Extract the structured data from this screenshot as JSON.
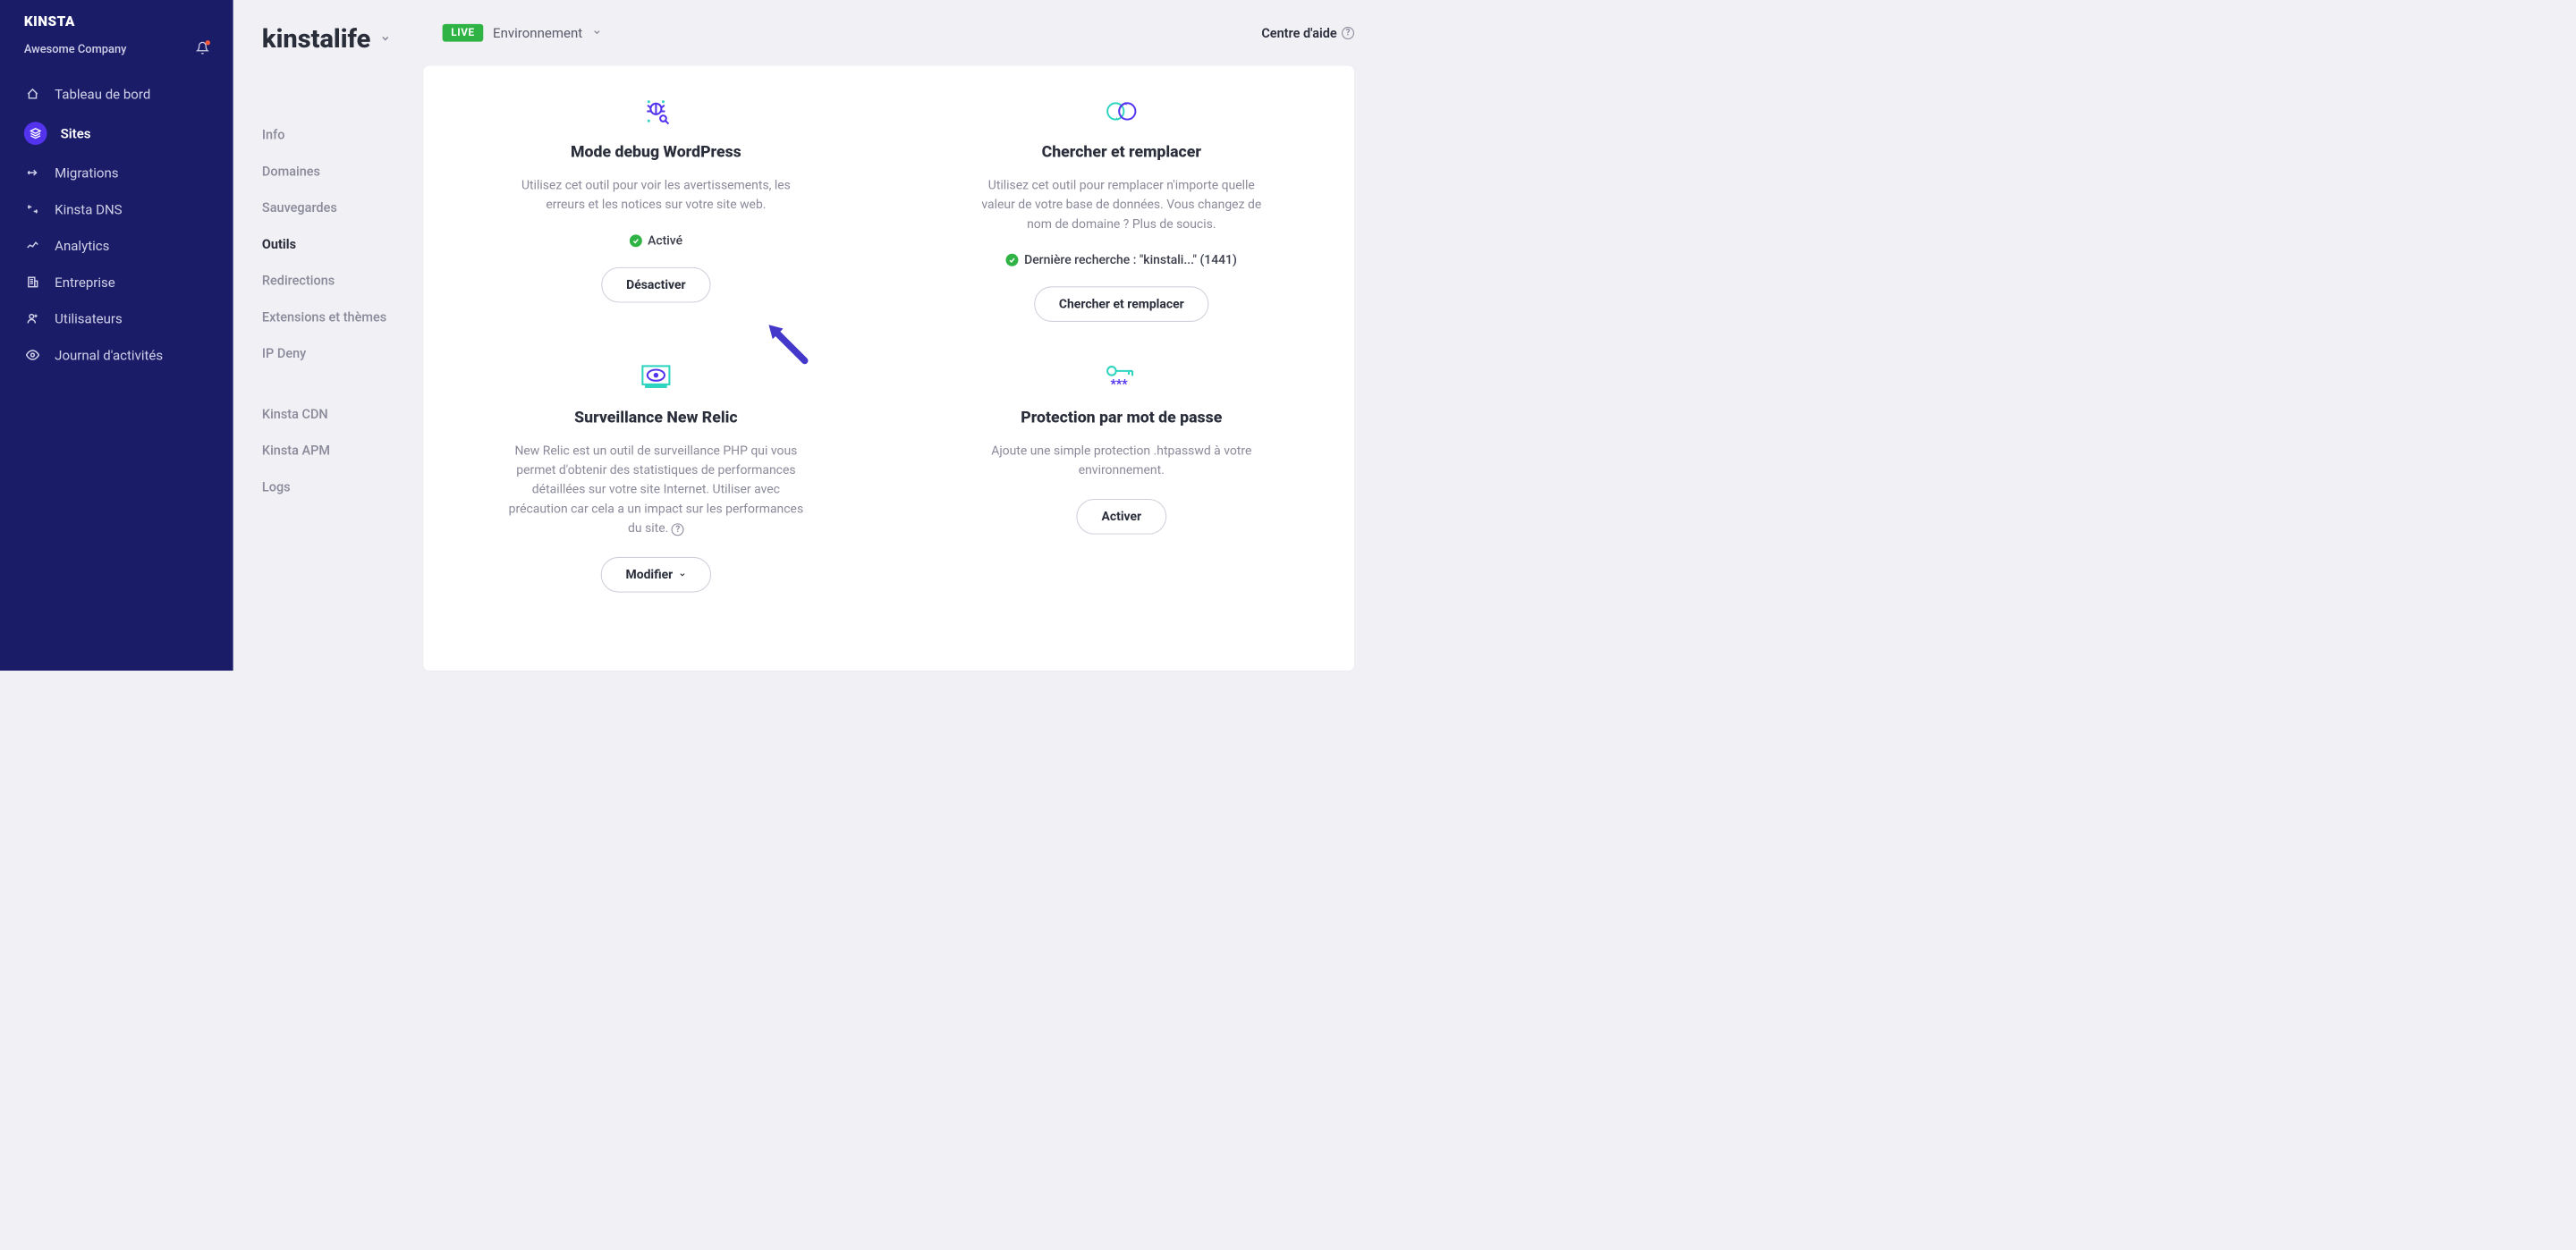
{
  "sidebar": {
    "company_name": "Awesome Company",
    "items": [
      {
        "label": "Tableau de bord",
        "icon": "home"
      },
      {
        "label": "Sites",
        "icon": "layers",
        "active": true
      },
      {
        "label": "Migrations",
        "icon": "arrow-right"
      },
      {
        "label": "Kinsta DNS",
        "icon": "dns"
      },
      {
        "label": "Analytics",
        "icon": "chart"
      },
      {
        "label": "Entreprise",
        "icon": "building"
      },
      {
        "label": "Utilisateurs",
        "icon": "user-plus"
      },
      {
        "label": "Journal d'activités",
        "icon": "eye"
      }
    ]
  },
  "site": {
    "name": "kinstalife",
    "env_badge": "LIVE",
    "env_label": "Environnement"
  },
  "help_link": "Centre d'aide",
  "subnav": {
    "items_a": [
      {
        "label": "Info"
      },
      {
        "label": "Domaines"
      },
      {
        "label": "Sauvegardes"
      },
      {
        "label": "Outils",
        "active": true
      },
      {
        "label": "Redirections"
      },
      {
        "label": "Extensions et thèmes"
      },
      {
        "label": "IP Deny"
      }
    ],
    "items_b": [
      {
        "label": "Kinsta CDN"
      },
      {
        "label": "Kinsta APM"
      },
      {
        "label": "Logs"
      }
    ]
  },
  "tools": {
    "debug": {
      "title": "Mode debug WordPress",
      "desc": "Utilisez cet outil pour voir les avertissements, les erreurs et les notices sur votre site web.",
      "status": "Activé",
      "button": "Désactiver"
    },
    "search_replace": {
      "title": "Chercher et remplacer",
      "desc": "Utilisez cet outil pour remplacer n'importe quelle valeur de votre base de données. Vous changez de nom de domaine ? Plus de soucis.",
      "status": "Dernière recherche : \"kinstali...\" (1441)",
      "button": "Chercher et remplacer"
    },
    "newrelic": {
      "title": "Surveillance New Relic",
      "desc": "New Relic est un outil de surveillance PHP qui vous permet d'obtenir des statistiques de performances détaillées sur votre site Internet. Utiliser avec précaution car cela a un impact sur les performances du site.",
      "button": "Modifier"
    },
    "password": {
      "title": "Protection par mot de passe",
      "desc": "Ajoute une simple protection .htpasswd à votre environnement.",
      "button": "Activer"
    }
  }
}
